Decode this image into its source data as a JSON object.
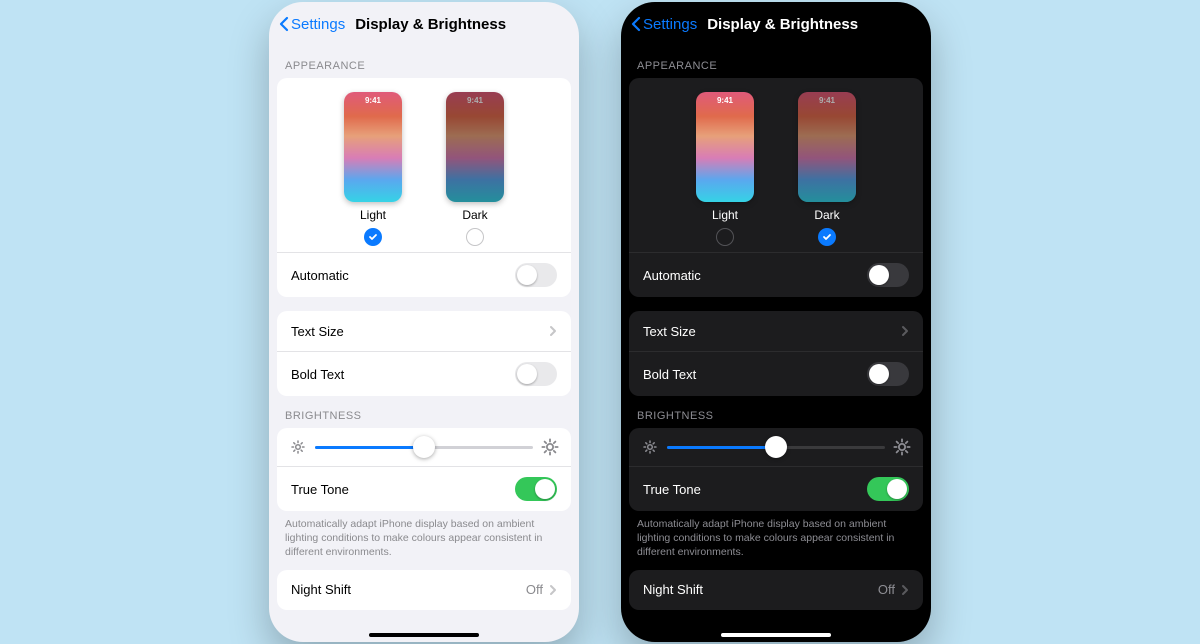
{
  "nav": {
    "back_label": "Settings",
    "title": "Display & Brightness"
  },
  "appearance": {
    "header": "APPEARANCE",
    "light_label": "Light",
    "dark_label": "Dark",
    "preview_time": "9:41",
    "automatic_label": "Automatic"
  },
  "text_section": {
    "text_size_label": "Text Size",
    "bold_text_label": "Bold Text"
  },
  "brightness": {
    "header": "BRIGHTNESS",
    "true_tone_label": "True Tone",
    "true_tone_note": "Automatically adapt iPhone display based on ambient lighting conditions to make colours appear consistent in different environments."
  },
  "night_shift": {
    "label": "Night Shift",
    "value": "Off"
  },
  "light_panel": {
    "selected_appearance": "light",
    "automatic_on": false,
    "bold_text_on": false,
    "brightness_percent": 50,
    "true_tone_on": true
  },
  "dark_panel": {
    "selected_appearance": "dark",
    "automatic_on": false,
    "bold_text_on": false,
    "brightness_percent": 50,
    "true_tone_on": true
  }
}
